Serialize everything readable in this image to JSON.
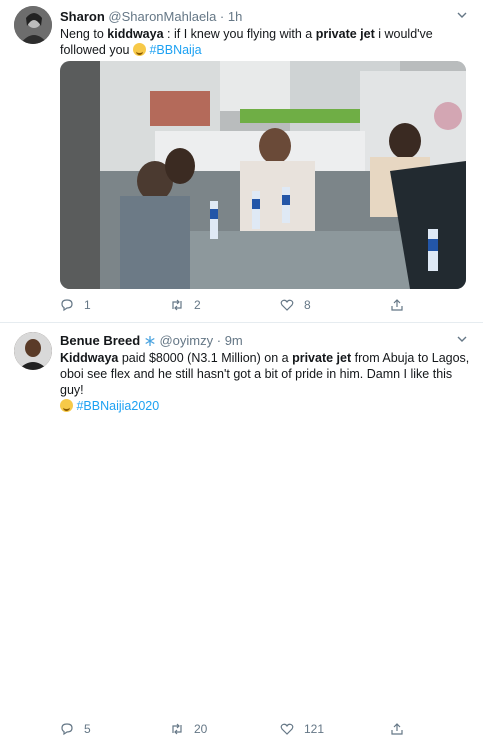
{
  "tweets": [
    {
      "name": "Sharon",
      "handle": "@SharonMahlaela",
      "separator": "·",
      "time": "1h",
      "text": {
        "t1": "Neng to ",
        "mention": "kiddwaya",
        "t2": " : if I knew you flying with a ",
        "bold": "private jet",
        "t3": " i would've followed you ",
        "hashtag": "#BBNaija"
      },
      "stats": {
        "replies": "1",
        "retweets": "2",
        "likes": "8"
      }
    },
    {
      "name": "Benue Breed",
      "handle": "@oyimzy",
      "separator": "·",
      "time": "9m",
      "text": {
        "mention": "Kiddwaya",
        "t1": " paid $8000 (N3.1 Million) on a ",
        "bold": "private jet",
        "t2": " from Abuja to Lagos, oboi see flex and he still hasn't got a bit of pride in him. Damn I like this guy!",
        "hashtag": "#BBNaijia2020"
      },
      "stats": {
        "replies": "5",
        "retweets": "20",
        "likes": "121"
      }
    }
  ],
  "colors": {
    "accent": "#1da1f2",
    "muted": "#657786",
    "text": "#14171a",
    "divider": "#e6ecf0"
  },
  "icons": [
    "reply-icon",
    "retweet-icon",
    "like-icon",
    "share-icon",
    "chevron-down-icon",
    "snowflake-icon",
    "laughing-emoji-icon"
  ]
}
